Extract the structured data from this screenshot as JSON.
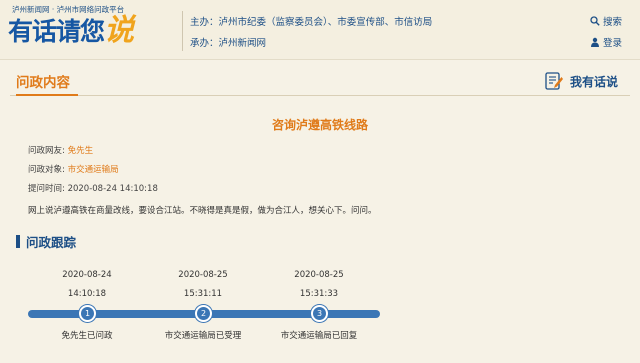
{
  "header": {
    "site_tag": "泸州新闻网 · 泸州市网络问政平台",
    "brand_main": "有话请您",
    "brand_accent": "说",
    "sponsor": "主办：泸州市纪委（监察委员会）、市委宣传部、市信访局",
    "organizer": "承办：泸州新闻网",
    "search_label": "搜索",
    "login_label": "登录"
  },
  "section": {
    "title": "问政内容",
    "speak_button": "我有话说"
  },
  "question": {
    "title": "咨询泸遵高铁线路",
    "asker_label": "问政网友:",
    "asker_value": "免先生",
    "target_label": "问政对象:",
    "target_value": "市交通运输局",
    "time_label": "提问时间:",
    "time_value": "2020-08-24 14:10:18",
    "content": "网上说泸遵高铁在商量改线，要设合江站。不晓得是真是假，做为合江人，想关心下。问问。"
  },
  "followup": {
    "title": "问政跟踪",
    "steps": [
      {
        "num": "1",
        "date": "2020-08-24",
        "time": "14:10:18",
        "desc": "免先生已问政"
      },
      {
        "num": "2",
        "date": "2020-08-25",
        "time": "15:31:11",
        "desc": "市交通运输局已受理"
      },
      {
        "num": "3",
        "date": "2020-08-25",
        "time": "15:31:33",
        "desc": "市交通运输局已回复"
      }
    ]
  },
  "colors": {
    "accent_orange": "#e07b1a",
    "brand_blue": "#1657a3",
    "timeline_blue": "#3b76b5",
    "background": "#f6f2e6"
  },
  "icons": [
    "search-icon",
    "user-icon",
    "edit-note-icon"
  ]
}
